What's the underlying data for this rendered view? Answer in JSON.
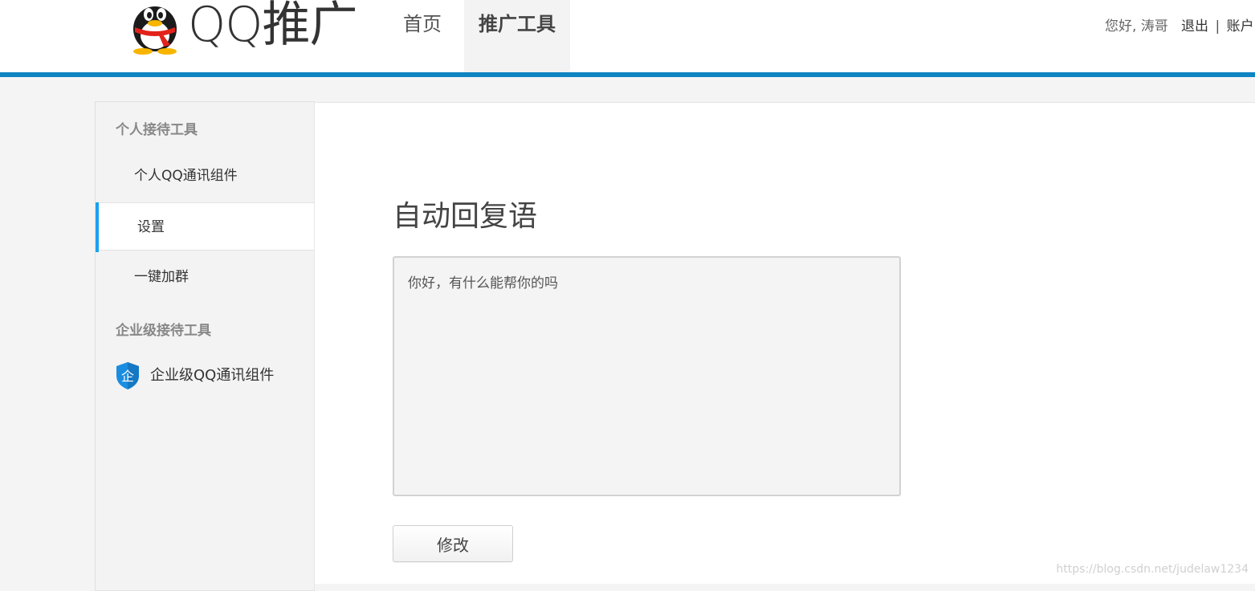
{
  "header": {
    "logo_text": "QQ推广",
    "nav": [
      {
        "label": "首页"
      },
      {
        "label": "推广工具"
      }
    ],
    "user": {
      "greeting": "您好, 涛哥",
      "logout": "退出",
      "separator": "|",
      "account": "账户"
    }
  },
  "colors": {
    "accent_bar": "#0e84c3",
    "sidebar_active_marker": "#1aa1f0",
    "enterprise_badge": "#1a8de0"
  },
  "sidebar": {
    "group_personal": "个人接待工具",
    "items_personal": [
      {
        "label": "个人QQ通讯组件"
      },
      {
        "label": "设置"
      },
      {
        "label": "一键加群"
      }
    ],
    "group_enterprise": "企业级接待工具",
    "enterprise_item": {
      "badge": "企",
      "label": "企业级QQ通讯组件",
      "icon": "enterprise-shield-icon"
    }
  },
  "main": {
    "title": "自动回复语",
    "reply_text": "你好，有什么能帮你的吗",
    "modify_label": "修改"
  },
  "watermark": "https://blog.csdn.net/judelaw1234"
}
